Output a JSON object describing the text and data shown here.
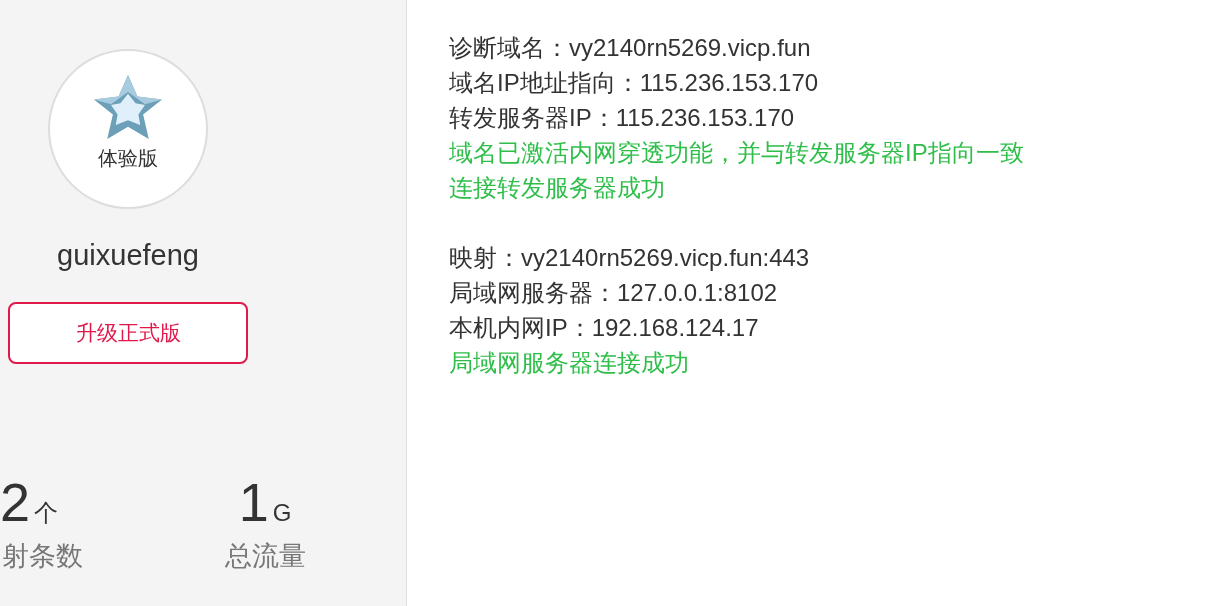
{
  "profile": {
    "badge": "体验版",
    "username": "guixuefeng",
    "upgrade_button": "升级正式版"
  },
  "stats": [
    {
      "value": "2",
      "unit": "个",
      "label": "射条数"
    },
    {
      "value": "1",
      "unit": "G",
      "label": "总流量"
    }
  ],
  "diagnosis": [
    {
      "lines": [
        {
          "kind": "info",
          "text": "诊断域名：vy2140rn5269.vicp.fun"
        },
        {
          "kind": "info",
          "text": "域名IP地址指向：115.236.153.170"
        },
        {
          "kind": "info",
          "text": "转发服务器IP：115.236.153.170"
        },
        {
          "kind": "success",
          "text": "域名已激活内网穿透功能，并与转发服务器IP指向一致"
        },
        {
          "kind": "success",
          "text": "连接转发服务器成功"
        }
      ]
    },
    {
      "lines": [
        {
          "kind": "info",
          "text": "映射：vy2140rn5269.vicp.fun:443"
        },
        {
          "kind": "info",
          "text": "局域网服务器：127.0.0.1:8102"
        },
        {
          "kind": "info",
          "text": "本机内网IP：192.168.124.17"
        },
        {
          "kind": "success",
          "text": "局域网服务器连接成功"
        }
      ]
    }
  ]
}
